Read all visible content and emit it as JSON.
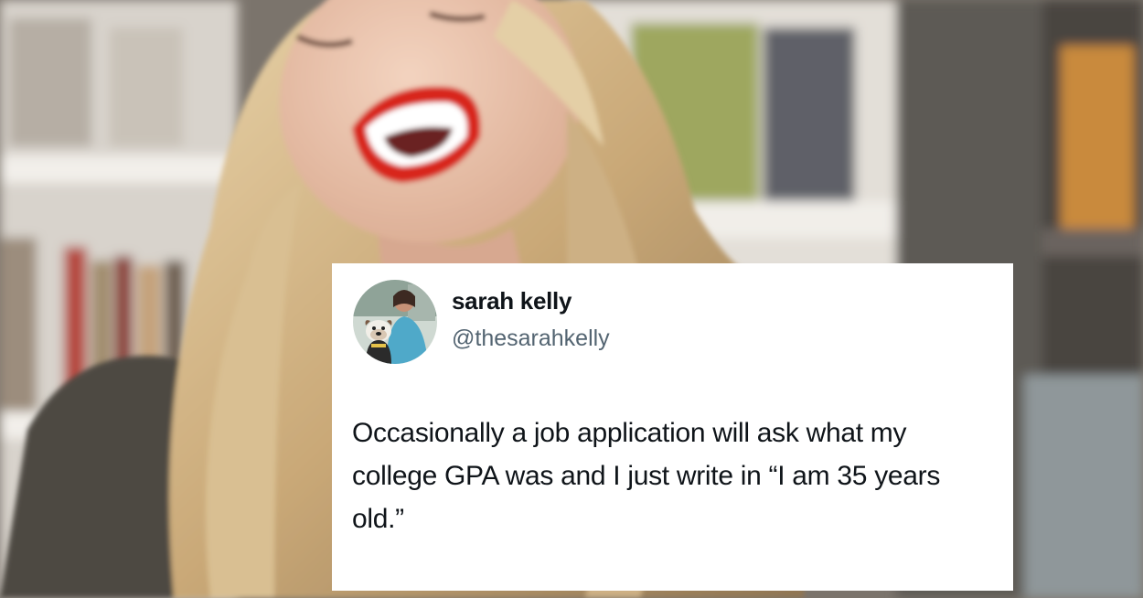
{
  "tweet": {
    "display_name": "sarah kelly",
    "handle": "@thesarahkelly",
    "text": "Occasionally a job application will ask what my college GPA was and I just write in “I am 35 years old.”"
  },
  "avatar": {
    "icon": "profile-photo-with-dog"
  },
  "colors": {
    "card_background": "#ffffff",
    "name_text": "#0f1419",
    "handle_text": "#536471",
    "lipstick": "#d8261e"
  }
}
